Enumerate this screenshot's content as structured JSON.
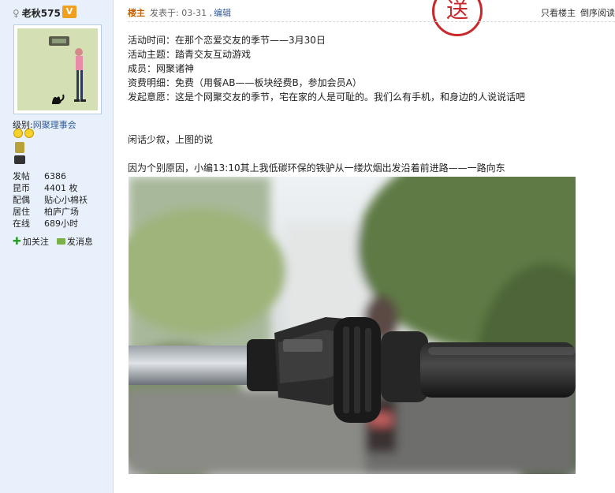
{
  "user": {
    "name": "老秋575",
    "badge": "V",
    "rank_label": "级别:",
    "rank_value": "网聚理事会",
    "stats": [
      {
        "label": "发帖",
        "value": "6386"
      },
      {
        "label": "昆币",
        "value": "4401 枚"
      },
      {
        "label": "配偶",
        "value": "贴心小棉袄"
      },
      {
        "label": "居住",
        "value": "柏庐广场"
      },
      {
        "label": "在线",
        "value": "689小时"
      }
    ],
    "follow_label": "加关注",
    "message_label": "发消息"
  },
  "post": {
    "op_label": "楼主",
    "posted_label": "发表于: 03-31 ,",
    "edit_label": "编辑",
    "only_op_label": "只看楼主",
    "reverse_label": "倒序阅读",
    "stamp_char": "送",
    "lines": [
      "活动时间：在那个恋爱交友的季节——3月30日",
      "活动主题：踏青交友互动游戏",
      "成员：网聚诸神",
      "资费明细：免费（用餐AB——板块经费B，参加会员A）",
      "发起意愿：这是个网聚交友的季节，宅在家的人是可耻的。我们么有手机，和身边的人说说话吧"
    ],
    "line_gossip": "闲话少叙，上图的说",
    "line_ride": "因为个别原因，小编13:10其上我低碳环保的铁驴从一缕炊烟出发沿着前进路——一路向东"
  },
  "colors": {
    "sidebar_bg": "#e8f1fb",
    "op_label": "#c66000",
    "link": "#335c9c",
    "stamp": "#c8282a"
  }
}
